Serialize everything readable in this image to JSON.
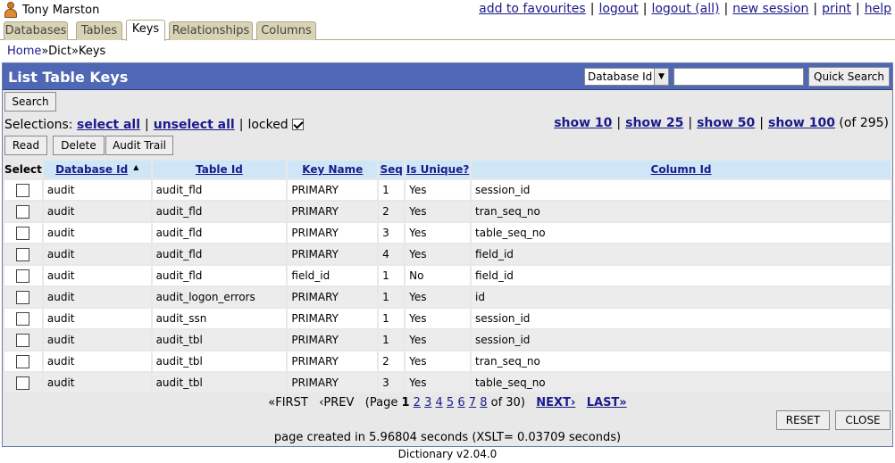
{
  "user": {
    "name": "Tony Marston",
    "icon": "user-icon"
  },
  "toplinks": [
    "add to favourites",
    "logout",
    "logout (all)",
    "new session",
    "print",
    "help"
  ],
  "tabs": [
    "Databases",
    "Tables",
    "Keys",
    "Relationships",
    "Columns"
  ],
  "active_tab": "Keys",
  "breadcrumb": {
    "home": "Home",
    "sep": "»",
    "dict": "Dict",
    "keys": "Keys"
  },
  "title": "List Table Keys",
  "quick_search": {
    "field": "Database Id",
    "value": "",
    "button": "Quick Search"
  },
  "search_button": "Search",
  "selections": {
    "label": "Selections:",
    "select_all": "select all",
    "unselect_all": "unselect all",
    "locked_label": "locked",
    "locked": true,
    "show": [
      "show 10",
      "show 25",
      "show 50",
      "show 100"
    ],
    "total": "(of 295)"
  },
  "actions": {
    "read": "Read",
    "delete": "Delete",
    "audit": "Audit Trail"
  },
  "columns": [
    "Select",
    "Database Id",
    "Table Id",
    "Key Name",
    "Seq",
    "Is Unique?",
    "Column Id"
  ],
  "rows": [
    {
      "db": "audit",
      "table": "audit_fld",
      "key": "PRIMARY",
      "seq": "1",
      "unique": "Yes",
      "col": "session_id"
    },
    {
      "db": "audit",
      "table": "audit_fld",
      "key": "PRIMARY",
      "seq": "2",
      "unique": "Yes",
      "col": "tran_seq_no"
    },
    {
      "db": "audit",
      "table": "audit_fld",
      "key": "PRIMARY",
      "seq": "3",
      "unique": "Yes",
      "col": "table_seq_no"
    },
    {
      "db": "audit",
      "table": "audit_fld",
      "key": "PRIMARY",
      "seq": "4",
      "unique": "Yes",
      "col": "field_id"
    },
    {
      "db": "audit",
      "table": "audit_fld",
      "key": "field_id",
      "seq": "1",
      "unique": "No",
      "col": "field_id"
    },
    {
      "db": "audit",
      "table": "audit_logon_errors",
      "key": "PRIMARY",
      "seq": "1",
      "unique": "Yes",
      "col": "id"
    },
    {
      "db": "audit",
      "table": "audit_ssn",
      "key": "PRIMARY",
      "seq": "1",
      "unique": "Yes",
      "col": "session_id"
    },
    {
      "db": "audit",
      "table": "audit_tbl",
      "key": "PRIMARY",
      "seq": "1",
      "unique": "Yes",
      "col": "session_id"
    },
    {
      "db": "audit",
      "table": "audit_tbl",
      "key": "PRIMARY",
      "seq": "2",
      "unique": "Yes",
      "col": "tran_seq_no"
    },
    {
      "db": "audit",
      "table": "audit_tbl",
      "key": "PRIMARY",
      "seq": "3",
      "unique": "Yes",
      "col": "table_seq_no"
    }
  ],
  "pager": {
    "first": "«FIRST",
    "prev": "‹PREV",
    "page_prefix": "(Page",
    "current": "1",
    "pages": [
      "2",
      "3",
      "4",
      "5",
      "6",
      "7",
      "8"
    ],
    "of": "of 30)",
    "next": "NEXT›",
    "last": "LAST»"
  },
  "bottom_buttons": {
    "reset": "RESET",
    "close": "CLOSE"
  },
  "created": "page created in 5.96804 seconds (XSLT= 0.03709 seconds)",
  "footer": "Dictionary v2.04.0"
}
